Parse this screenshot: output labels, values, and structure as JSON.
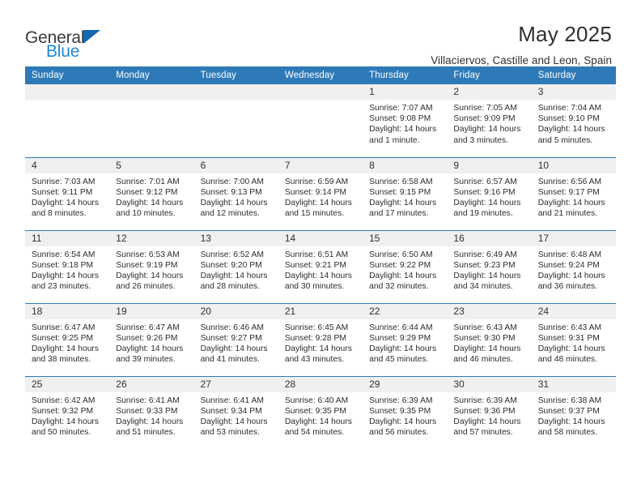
{
  "brand": {
    "name_part1": "General",
    "name_part2": "Blue",
    "logo_icon": "triangle-logo-icon",
    "color_primary": "#2089d6",
    "color_dark": "#3b3b3b"
  },
  "header": {
    "title": "May 2025",
    "subtitle": "Villaciervos, Castille and Leon, Spain"
  },
  "theme": {
    "header_blue": "#2e7ab8",
    "daynum_gray": "#f0f0f0"
  },
  "weekdays": [
    "Sunday",
    "Monday",
    "Tuesday",
    "Wednesday",
    "Thursday",
    "Friday",
    "Saturday"
  ],
  "labels": {
    "sunrise": "Sunrise:",
    "sunset": "Sunset:",
    "daylight": "Daylight:"
  },
  "weeks": [
    [
      {
        "day": "",
        "sunrise": "",
        "sunset": "",
        "daylight_line1": "",
        "daylight_line2": ""
      },
      {
        "day": "",
        "sunrise": "",
        "sunset": "",
        "daylight_line1": "",
        "daylight_line2": ""
      },
      {
        "day": "",
        "sunrise": "",
        "sunset": "",
        "daylight_line1": "",
        "daylight_line2": ""
      },
      {
        "day": "",
        "sunrise": "",
        "sunset": "",
        "daylight_line1": "",
        "daylight_line2": ""
      },
      {
        "day": "1",
        "sunrise": "Sunrise: 7:07 AM",
        "sunset": "Sunset: 9:08 PM",
        "daylight_line1": "Daylight: 14 hours",
        "daylight_line2": "and 1 minute."
      },
      {
        "day": "2",
        "sunrise": "Sunrise: 7:05 AM",
        "sunset": "Sunset: 9:09 PM",
        "daylight_line1": "Daylight: 14 hours",
        "daylight_line2": "and 3 minutes."
      },
      {
        "day": "3",
        "sunrise": "Sunrise: 7:04 AM",
        "sunset": "Sunset: 9:10 PM",
        "daylight_line1": "Daylight: 14 hours",
        "daylight_line2": "and 5 minutes."
      }
    ],
    [
      {
        "day": "4",
        "sunrise": "Sunrise: 7:03 AM",
        "sunset": "Sunset: 9:11 PM",
        "daylight_line1": "Daylight: 14 hours",
        "daylight_line2": "and 8 minutes."
      },
      {
        "day": "5",
        "sunrise": "Sunrise: 7:01 AM",
        "sunset": "Sunset: 9:12 PM",
        "daylight_line1": "Daylight: 14 hours",
        "daylight_line2": "and 10 minutes."
      },
      {
        "day": "6",
        "sunrise": "Sunrise: 7:00 AM",
        "sunset": "Sunset: 9:13 PM",
        "daylight_line1": "Daylight: 14 hours",
        "daylight_line2": "and 12 minutes."
      },
      {
        "day": "7",
        "sunrise": "Sunrise: 6:59 AM",
        "sunset": "Sunset: 9:14 PM",
        "daylight_line1": "Daylight: 14 hours",
        "daylight_line2": "and 15 minutes."
      },
      {
        "day": "8",
        "sunrise": "Sunrise: 6:58 AM",
        "sunset": "Sunset: 9:15 PM",
        "daylight_line1": "Daylight: 14 hours",
        "daylight_line2": "and 17 minutes."
      },
      {
        "day": "9",
        "sunrise": "Sunrise: 6:57 AM",
        "sunset": "Sunset: 9:16 PM",
        "daylight_line1": "Daylight: 14 hours",
        "daylight_line2": "and 19 minutes."
      },
      {
        "day": "10",
        "sunrise": "Sunrise: 6:56 AM",
        "sunset": "Sunset: 9:17 PM",
        "daylight_line1": "Daylight: 14 hours",
        "daylight_line2": "and 21 minutes."
      }
    ],
    [
      {
        "day": "11",
        "sunrise": "Sunrise: 6:54 AM",
        "sunset": "Sunset: 9:18 PM",
        "daylight_line1": "Daylight: 14 hours",
        "daylight_line2": "and 23 minutes."
      },
      {
        "day": "12",
        "sunrise": "Sunrise: 6:53 AM",
        "sunset": "Sunset: 9:19 PM",
        "daylight_line1": "Daylight: 14 hours",
        "daylight_line2": "and 26 minutes."
      },
      {
        "day": "13",
        "sunrise": "Sunrise: 6:52 AM",
        "sunset": "Sunset: 9:20 PM",
        "daylight_line1": "Daylight: 14 hours",
        "daylight_line2": "and 28 minutes."
      },
      {
        "day": "14",
        "sunrise": "Sunrise: 6:51 AM",
        "sunset": "Sunset: 9:21 PM",
        "daylight_line1": "Daylight: 14 hours",
        "daylight_line2": "and 30 minutes."
      },
      {
        "day": "15",
        "sunrise": "Sunrise: 6:50 AM",
        "sunset": "Sunset: 9:22 PM",
        "daylight_line1": "Daylight: 14 hours",
        "daylight_line2": "and 32 minutes."
      },
      {
        "day": "16",
        "sunrise": "Sunrise: 6:49 AM",
        "sunset": "Sunset: 9:23 PM",
        "daylight_line1": "Daylight: 14 hours",
        "daylight_line2": "and 34 minutes."
      },
      {
        "day": "17",
        "sunrise": "Sunrise: 6:48 AM",
        "sunset": "Sunset: 9:24 PM",
        "daylight_line1": "Daylight: 14 hours",
        "daylight_line2": "and 36 minutes."
      }
    ],
    [
      {
        "day": "18",
        "sunrise": "Sunrise: 6:47 AM",
        "sunset": "Sunset: 9:25 PM",
        "daylight_line1": "Daylight: 14 hours",
        "daylight_line2": "and 38 minutes."
      },
      {
        "day": "19",
        "sunrise": "Sunrise: 6:47 AM",
        "sunset": "Sunset: 9:26 PM",
        "daylight_line1": "Daylight: 14 hours",
        "daylight_line2": "and 39 minutes."
      },
      {
        "day": "20",
        "sunrise": "Sunrise: 6:46 AM",
        "sunset": "Sunset: 9:27 PM",
        "daylight_line1": "Daylight: 14 hours",
        "daylight_line2": "and 41 minutes."
      },
      {
        "day": "21",
        "sunrise": "Sunrise: 6:45 AM",
        "sunset": "Sunset: 9:28 PM",
        "daylight_line1": "Daylight: 14 hours",
        "daylight_line2": "and 43 minutes."
      },
      {
        "day": "22",
        "sunrise": "Sunrise: 6:44 AM",
        "sunset": "Sunset: 9:29 PM",
        "daylight_line1": "Daylight: 14 hours",
        "daylight_line2": "and 45 minutes."
      },
      {
        "day": "23",
        "sunrise": "Sunrise: 6:43 AM",
        "sunset": "Sunset: 9:30 PM",
        "daylight_line1": "Daylight: 14 hours",
        "daylight_line2": "and 46 minutes."
      },
      {
        "day": "24",
        "sunrise": "Sunrise: 6:43 AM",
        "sunset": "Sunset: 9:31 PM",
        "daylight_line1": "Daylight: 14 hours",
        "daylight_line2": "and 48 minutes."
      }
    ],
    [
      {
        "day": "25",
        "sunrise": "Sunrise: 6:42 AM",
        "sunset": "Sunset: 9:32 PM",
        "daylight_line1": "Daylight: 14 hours",
        "daylight_line2": "and 50 minutes."
      },
      {
        "day": "26",
        "sunrise": "Sunrise: 6:41 AM",
        "sunset": "Sunset: 9:33 PM",
        "daylight_line1": "Daylight: 14 hours",
        "daylight_line2": "and 51 minutes."
      },
      {
        "day": "27",
        "sunrise": "Sunrise: 6:41 AM",
        "sunset": "Sunset: 9:34 PM",
        "daylight_line1": "Daylight: 14 hours",
        "daylight_line2": "and 53 minutes."
      },
      {
        "day": "28",
        "sunrise": "Sunrise: 6:40 AM",
        "sunset": "Sunset: 9:35 PM",
        "daylight_line1": "Daylight: 14 hours",
        "daylight_line2": "and 54 minutes."
      },
      {
        "day": "29",
        "sunrise": "Sunrise: 6:39 AM",
        "sunset": "Sunset: 9:35 PM",
        "daylight_line1": "Daylight: 14 hours",
        "daylight_line2": "and 56 minutes."
      },
      {
        "day": "30",
        "sunrise": "Sunrise: 6:39 AM",
        "sunset": "Sunset: 9:36 PM",
        "daylight_line1": "Daylight: 14 hours",
        "daylight_line2": "and 57 minutes."
      },
      {
        "day": "31",
        "sunrise": "Sunrise: 6:38 AM",
        "sunset": "Sunset: 9:37 PM",
        "daylight_line1": "Daylight: 14 hours",
        "daylight_line2": "and 58 minutes."
      }
    ]
  ]
}
